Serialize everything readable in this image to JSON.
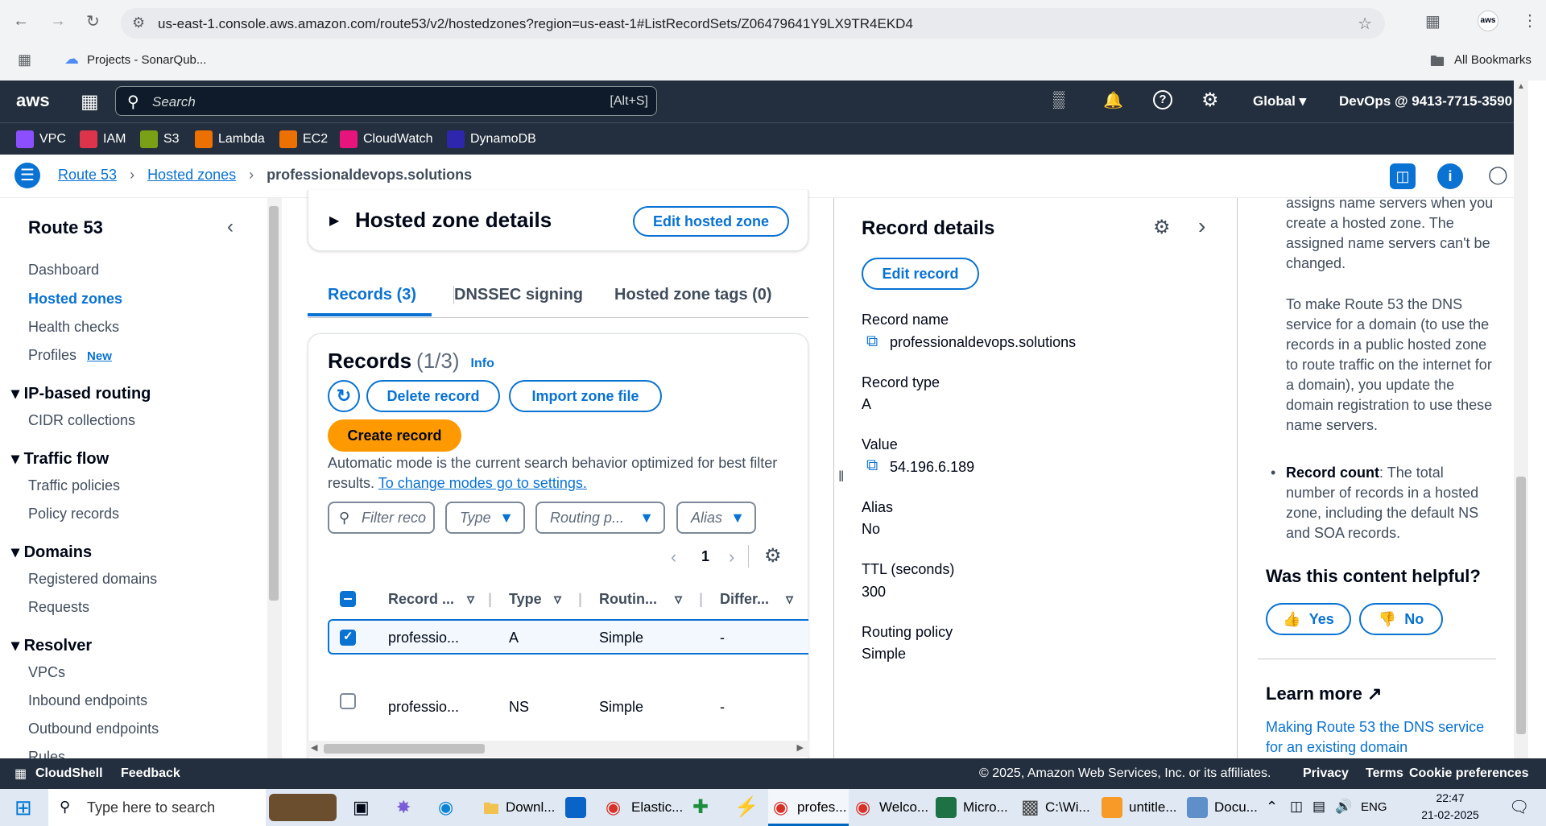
{
  "browser": {
    "url": "us-east-1.console.aws.amazon.com/route53/v2/hostedzones?region=us-east-1#ListRecordSets/Z06479641Y9LX9TR4EKD4",
    "bookmark_projects": "Projects - SonarQub...",
    "all_bookmarks": "All Bookmarks"
  },
  "aws_nav": {
    "logo": "aws",
    "search_placeholder": "Search",
    "search_shortcut": "[Alt+S]",
    "region": "Global",
    "account": "DevOps @ 9413-7715-3590",
    "favorites": [
      {
        "label": "VPC",
        "color": "#8c4fff"
      },
      {
        "label": "IAM",
        "color": "#dd344c"
      },
      {
        "label": "S3",
        "color": "#7aa116"
      },
      {
        "label": "Lambda",
        "color": "#ed7100"
      },
      {
        "label": "EC2",
        "color": "#ed7100"
      },
      {
        "label": "CloudWatch",
        "color": "#e7157b"
      },
      {
        "label": "DynamoDB",
        "color": "#2e27ad"
      }
    ]
  },
  "breadcrumb": {
    "items": [
      "Route 53",
      "Hosted zones",
      "professionaldevops.solutions"
    ]
  },
  "left_nav": {
    "title": "Route 53",
    "items": [
      "Dashboard",
      "Hosted zones",
      "Health checks",
      "Profiles"
    ],
    "profiles_badge": "New",
    "sections": [
      {
        "title": "IP-based routing",
        "items": [
          "CIDR collections"
        ]
      },
      {
        "title": "Traffic flow",
        "items": [
          "Traffic policies",
          "Policy records"
        ]
      },
      {
        "title": "Domains",
        "items": [
          "Registered domains",
          "Requests"
        ]
      },
      {
        "title": "Resolver",
        "items": [
          "VPCs",
          "Inbound endpoints",
          "Outbound endpoints",
          "Rules"
        ]
      }
    ]
  },
  "main": {
    "hosted_zone_details": "Hosted zone details",
    "edit_hosted_zone": "Edit hosted zone",
    "tabs": [
      "Records (3)",
      "DNSSEC signing",
      "Hosted zone tags (0)"
    ],
    "records_title": "Records",
    "records_count": "(1/3)",
    "info": "Info",
    "delete_record": "Delete record",
    "import_zone_file": "Import zone file",
    "create_record": "Create record",
    "mode_text": "Automatic mode is the current search behavior optimized for best filter results.",
    "mode_link": "To change modes go to settings.",
    "filter_placeholder": "Filter reco",
    "type_select": "Type",
    "routing_select": "Routing p...",
    "alias_select": "Alias",
    "page_number": "1",
    "columns": [
      "Record ...",
      "Type",
      "Routin...",
      "Differ..."
    ],
    "rows": [
      {
        "name": "professio...",
        "type": "A",
        "routing": "Simple",
        "differ": "-",
        "selected": true
      },
      {
        "name": "professio...",
        "type": "NS",
        "routing": "Simple",
        "differ": "-",
        "selected": false
      }
    ]
  },
  "details": {
    "title": "Record details",
    "edit_record": "Edit record",
    "record_name_label": "Record name",
    "record_name": "professionaldevops.solutions",
    "record_type_label": "Record type",
    "record_type": "A",
    "value_label": "Value",
    "value": "54.196.6.189",
    "alias_label": "Alias",
    "alias": "No",
    "ttl_label": "TTL (seconds)",
    "ttl": "300",
    "routing_label": "Routing policy",
    "routing": "Simple"
  },
  "help": {
    "para1": "assigns name servers when you create a hosted zone. The assigned name servers can't be changed.",
    "para2": "To make Route 53 the DNS service for a domain (to use the records in a public hosted zone to route traffic on the internet for a domain), you update the domain registration to use these name servers.",
    "bullet_bold": "Record count",
    "bullet_text": ": The total number of records in a hosted zone, including the default NS and SOA records.",
    "helpful_title": "Was this content helpful?",
    "yes": "Yes",
    "no": "No",
    "learn_more": "Learn more",
    "learn_link": "Making Route 53 the DNS service for an existing domain"
  },
  "footer": {
    "cloudshell": "CloudShell",
    "feedback": "Feedback",
    "copyright": "© 2025, Amazon Web Services, Inc. or its affiliates.",
    "privacy": "Privacy",
    "terms": "Terms",
    "cookie": "Cookie preferences"
  },
  "taskbar": {
    "search": "Type here to search",
    "apps": [
      "Downl...",
      "Elastic...",
      "profes...",
      "Welco...",
      "Micro...",
      "C:\\Wi...",
      "untitle...",
      "Docu..."
    ],
    "lang": "ENG",
    "time": "22:47",
    "date": "21-02-2025"
  }
}
